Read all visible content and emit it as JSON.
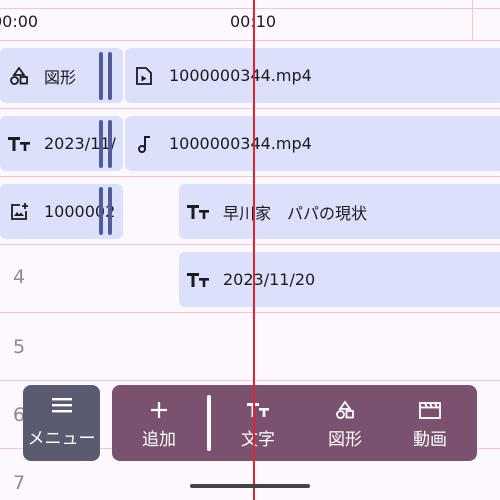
{
  "ruler": {
    "start": "00:00",
    "mid": "00:10"
  },
  "rows": [
    "4",
    "5",
    "6",
    "7"
  ],
  "clips": {
    "shape": {
      "label": "図形"
    },
    "video": {
      "label": "1000000344.mp4"
    },
    "text1": {
      "label": "2023/11/"
    },
    "audio": {
      "label": "1000000344.mp4"
    },
    "image": {
      "label": "1000002"
    },
    "text2": {
      "label": "早川家　パパの現状"
    },
    "text3": {
      "label": "2023/11/20"
    }
  },
  "menu": {
    "label": "メニュー"
  },
  "toolbar": {
    "add": "追加",
    "text": "文字",
    "shape": "図形",
    "video": "動画"
  },
  "colors": {
    "background": "#FCF8FD",
    "clip": "#DCE0FB",
    "playhead": "#E1232B",
    "toolbar": "#7A5270",
    "menu": "#5A5B70"
  }
}
